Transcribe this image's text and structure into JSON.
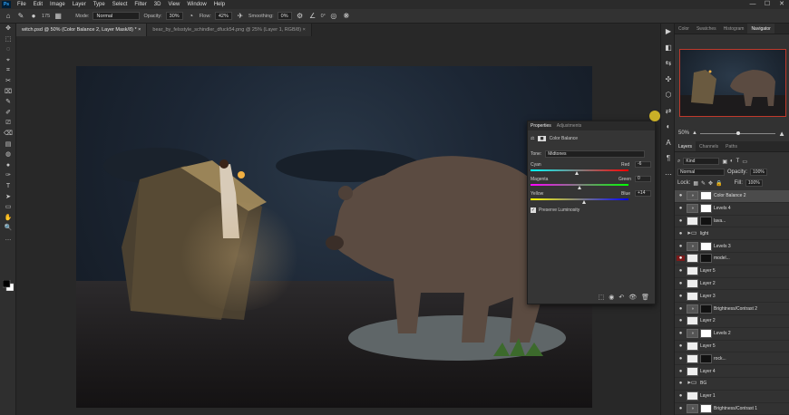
{
  "menu": [
    "File",
    "Edit",
    "Image",
    "Layer",
    "Type",
    "Select",
    "Filter",
    "3D",
    "View",
    "Window",
    "Help"
  ],
  "window_controls": [
    "—",
    "☐",
    "✕"
  ],
  "options": {
    "mode_label": "Mode:",
    "mode_value": "Normal",
    "opacity_label": "Opacity:",
    "opacity_value": "30%",
    "flow_label": "Flow:",
    "flow_value": "42%",
    "smoothing_label": "Smoothing:",
    "smoothing_value": "0%",
    "angle_value": "0°",
    "brush_size": "175"
  },
  "tabs": [
    {
      "label": "witch.psd @ 50% (Color Balance 2, Layer Mask/8) *",
      "active": true,
      "close": "×"
    },
    {
      "label": "bear_by_felsstyle_schindler_dfuck54.png @ 25% (Layer 1, RGB/8)",
      "active": false,
      "close": "×"
    }
  ],
  "tools": [
    "✥",
    "⬚",
    "◌",
    "⌖",
    "⌗",
    "✂",
    "⌧",
    "✎",
    "✐",
    "⎚",
    "⌫",
    "▤",
    "◍",
    "●",
    "✑",
    "T",
    "➤",
    "▭",
    "✋",
    "🔍",
    "…"
  ],
  "dock_icons": [
    "▶",
    "◧",
    "⇆",
    "✣",
    "⬡",
    "⇄",
    "◐",
    "A",
    "¶",
    "⋯"
  ],
  "panel_tabs": [
    "Color",
    "Swatches",
    "Histogram",
    "Navigator"
  ],
  "active_panel_tab": "Navigator",
  "zoom": "50%",
  "layers_tabs": [
    "Layers",
    "Channels",
    "Paths"
  ],
  "layer_filter": "Kind",
  "blend_mode": "Normal",
  "opacity_label": "Opacity:",
  "opacity": "100%",
  "lock_label": "Lock:",
  "fill_label": "Fill:",
  "fill": "100%",
  "layers": [
    {
      "name": "Color Balance 2",
      "thumb": "adj",
      "mask": "mask",
      "selected": true,
      "eye": "●"
    },
    {
      "name": "Levels 4",
      "thumb": "adj",
      "mask": "mask",
      "eye": "●"
    },
    {
      "name": "lava...",
      "thumb": "img",
      "mask": "dark",
      "eye": "●"
    },
    {
      "name": "light",
      "thumb": "folder",
      "mask": "",
      "eye": "●"
    },
    {
      "name": "Levels 3",
      "thumb": "adj",
      "mask": "mask",
      "eye": "●"
    },
    {
      "name": "model...",
      "thumb": "img",
      "mask": "dark",
      "eye": "●",
      "red": true
    },
    {
      "name": "Layer 5",
      "thumb": "img",
      "mask": "",
      "eye": "●"
    },
    {
      "name": "Layer 2",
      "thumb": "img",
      "mask": "",
      "eye": "●"
    },
    {
      "name": "Layer 3",
      "thumb": "img",
      "mask": "",
      "eye": "●"
    },
    {
      "name": "Brightness/Contrast 2",
      "thumb": "adj",
      "mask": "dark",
      "eye": "●"
    },
    {
      "name": "Layer 2",
      "thumb": "img",
      "mask": "",
      "eye": "●"
    },
    {
      "name": "Levels 2",
      "thumb": "adj",
      "mask": "mask",
      "eye": "●"
    },
    {
      "name": "Layer 5",
      "thumb": "img",
      "mask": "",
      "eye": "●"
    },
    {
      "name": "rock...",
      "thumb": "img",
      "mask": "dark",
      "eye": "●"
    },
    {
      "name": "Layer 4",
      "thumb": "img",
      "mask": "",
      "eye": "●"
    },
    {
      "name": "BG",
      "thumb": "folder",
      "mask": "",
      "eye": "●"
    },
    {
      "name": "Layer 1",
      "thumb": "img",
      "mask": "",
      "eye": "●"
    },
    {
      "name": "Brightness/Contrast 1",
      "thumb": "adj",
      "mask": "mask",
      "eye": "●"
    }
  ],
  "properties": {
    "tab_active": "Properties",
    "tab_other": "Adjustments",
    "title": "Color Balance",
    "tone_label": "Tone:",
    "tone_value": "Midtones",
    "cyan": "Cyan",
    "red": "Red",
    "cyan_red_value": "-6",
    "magenta": "Magenta",
    "green": "Green",
    "magenta_green_value": "0",
    "yellow": "Yellow",
    "blue": "Blue",
    "yellow_blue_value": "+14",
    "preserve": "Preserve Luminosity",
    "preserve_checked": true,
    "footer_icons": [
      "⬚",
      "◉",
      "↶",
      "👁",
      "🗑"
    ],
    "cyan_red_pos": 0.48,
    "magenta_green_pos": 0.5,
    "yellow_blue_pos": 0.55
  }
}
